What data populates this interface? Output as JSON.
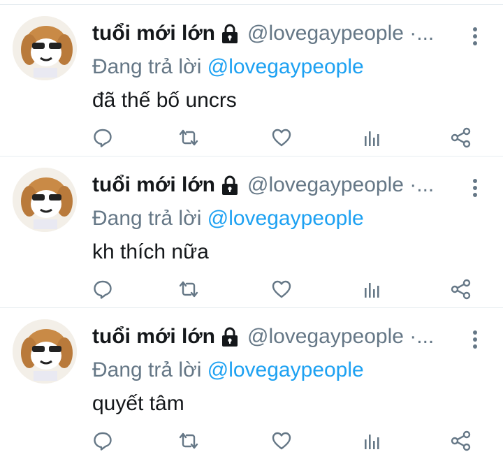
{
  "colors": {
    "text": "#14171a",
    "secondary": "#657786",
    "link": "#1da1f2",
    "divider": "#e6ecf0",
    "icon": "#657786"
  },
  "icons": {
    "lock": "lock-icon",
    "more": "more-vertical-icon",
    "reply": "reply-icon",
    "retweet": "retweet-icon",
    "like": "heart-icon",
    "analytics": "analytics-icon",
    "share": "share-icon"
  },
  "tweets": [
    {
      "display_name": "tuổi mới lớn",
      "handle": "@lovegaypeople ·...",
      "reply_prefix": "Đang trả lời",
      "reply_to": "@lovegaypeople",
      "text": "đã thế bố uncrs"
    },
    {
      "display_name": "tuổi mới lớn",
      "handle": "@lovegaypeople ·...",
      "reply_prefix": "Đang trả lời",
      "reply_to": "@lovegaypeople",
      "text": "kh thích nữa"
    },
    {
      "display_name": "tuổi mới lớn",
      "handle": "@lovegaypeople ·...",
      "reply_prefix": "Đang trả lời",
      "reply_to": "@lovegaypeople",
      "text": "quyết tâm"
    }
  ]
}
